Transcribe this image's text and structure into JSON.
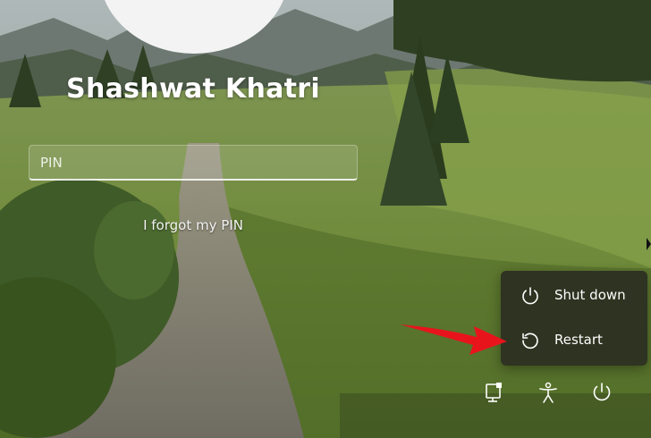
{
  "user": {
    "name": "Shashwat Khatri"
  },
  "pin": {
    "placeholder": "PIN",
    "value": ""
  },
  "forgot_link": "I forgot my PIN",
  "power_menu": {
    "items": [
      {
        "label": "Shut down",
        "icon": "power-icon"
      },
      {
        "label": "Restart",
        "icon": "restart-icon"
      }
    ]
  },
  "tray": {
    "icons": [
      "network-icon",
      "accessibility-icon",
      "power-icon"
    ]
  },
  "colors": {
    "annotation_arrow": "#e8141c",
    "menu_background": "#2c2e20"
  }
}
